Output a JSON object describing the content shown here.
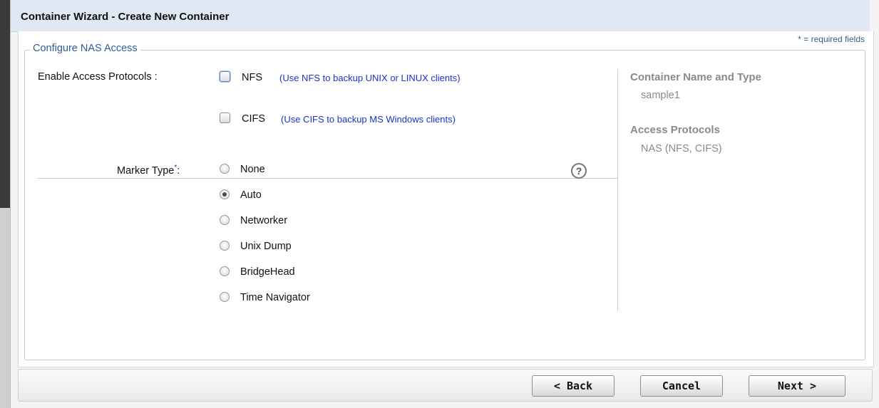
{
  "dialog": {
    "title": "Container Wizard - Create New Container",
    "required_note": "* = required fields"
  },
  "section": {
    "legend": "Configure NAS Access"
  },
  "access": {
    "label": "Enable Access Protocols :",
    "protocols": [
      {
        "name": "NFS",
        "hint": "(Use NFS to backup UNIX or LINUX clients)",
        "checked": false
      },
      {
        "name": "CIFS",
        "hint": "(Use CIFS to backup MS Windows clients)",
        "checked": false
      }
    ]
  },
  "marker": {
    "label": "Marker Type",
    "required_mark": "*",
    "colon": ":",
    "help": "?",
    "options": [
      {
        "label": "None",
        "selected": false
      },
      {
        "label": "Auto",
        "selected": true
      },
      {
        "label": "Networker",
        "selected": false
      },
      {
        "label": "Unix Dump",
        "selected": false
      },
      {
        "label": "BridgeHead",
        "selected": false
      },
      {
        "label": "Time Navigator",
        "selected": false
      }
    ]
  },
  "summary": {
    "container_heading": "Container Name and Type",
    "container_value": "sample1",
    "protocols_heading": "Access Protocols",
    "protocols_value": "NAS (NFS, CIFS)"
  },
  "buttons": {
    "back": "< Back",
    "cancel": "Cancel",
    "next": "Next >"
  },
  "colors": {
    "legend": "#2f5d98",
    "hint": "#1b33c8",
    "title_bar": "#dfe8f3"
  }
}
